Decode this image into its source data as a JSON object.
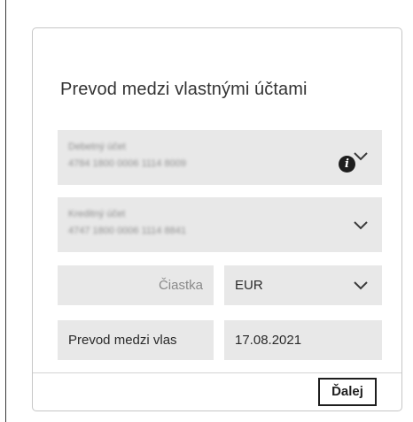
{
  "dialog": {
    "title": "Prevod medzi vlastnými účtami"
  },
  "from_account": {
    "label": "Debetný účet",
    "number": "4784 1800 0006 1114 8009"
  },
  "to_account": {
    "label": "Kreditný účet",
    "number": "4747 1800 0006 1114 8841"
  },
  "amount": {
    "placeholder": "Čiastka",
    "currency": "EUR"
  },
  "description": {
    "value": "Prevod medzi vlas"
  },
  "date": {
    "value": "17.08.2021"
  },
  "actions": {
    "next_label": "Ďalej"
  },
  "icons": {
    "info": "info-icon",
    "chevron": "chevron-down-icon"
  },
  "colors": {
    "field_bg": "#e8e8e8",
    "border": "#c6c6c6",
    "text": "#222222"
  }
}
